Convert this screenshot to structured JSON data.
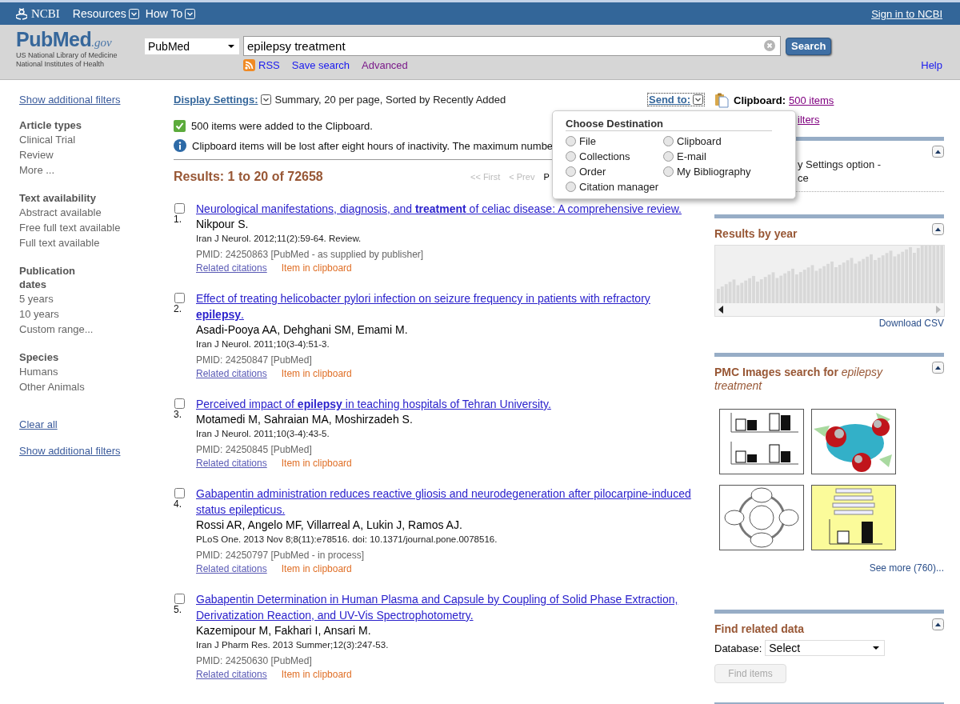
{
  "ncbi_bar": {
    "logo": "NCBI",
    "menus": [
      {
        "label": "Resources"
      },
      {
        "label": "How To"
      }
    ],
    "sign_in": "Sign in to NCBI"
  },
  "header": {
    "logo": {
      "brand": "PubMed",
      "suffix": ".gov",
      "lines": [
        "US National Library of Medicine",
        "National Institutes of Health"
      ]
    },
    "database": "PubMed",
    "query": "epilepsy treatment",
    "search_button": "Search",
    "links": [
      {
        "kind": "rss",
        "label": "RSS"
      },
      {
        "kind": "link",
        "label": "Save search"
      },
      {
        "kind": "visited",
        "label": "Advanced"
      }
    ],
    "help": "Help"
  },
  "filters": {
    "top_link": "Show additional filters",
    "groups": [
      {
        "title": "Article types",
        "items": [
          "Clinical Trial",
          "Review",
          "More ..."
        ]
      },
      {
        "title": "Text availability",
        "items": [
          "Abstract available",
          "Free full text available",
          "Full text available"
        ]
      },
      {
        "title": "Publication dates",
        "items": [
          "5 years",
          "10 years",
          "Custom range..."
        ]
      },
      {
        "title": "Species",
        "items": [
          "Humans",
          "Other Animals"
        ]
      }
    ],
    "clear": "Clear all",
    "bottom_link": "Show additional filters"
  },
  "display_settings": {
    "label": "Display Settings:",
    "value": "Summary, 20 per page, Sorted by Recently Added"
  },
  "send_to": "Send to:",
  "clipboard": {
    "label": "Clipboard:",
    "count": "500 items"
  },
  "messages": [
    {
      "kind": "success",
      "text": "500 items were added to the Clipboard."
    },
    {
      "kind": "info",
      "text": "Clipboard items will be lost after eight hours of inactivity. The maximum numbe"
    }
  ],
  "results_header": "Results: 1 to 20 of 72658",
  "pager": [
    {
      "label": "<< First",
      "disabled": true
    },
    {
      "label": "< Prev",
      "disabled": true
    },
    {
      "label": "P",
      "disabled": false
    }
  ],
  "results": [
    {
      "number": "1.",
      "checked": false,
      "title": "Neurological manifestations, diagnosis, and **treatment** of celiac disease: A comprehensive review.",
      "authors": "Nikpour S.",
      "citation": "Iran J Neurol. 2012;11(2):59-64. Review.",
      "pmid": "PMID: 24250863 [PubMed - as supplied by publisher]",
      "related": "Related citations",
      "status": "Item in clipboard"
    },
    {
      "number": "2.",
      "checked": false,
      "title": "Effect of treating helicobacter pylori infection on seizure frequency in patients with refractory **epilepsy**.",
      "authors": "Asadi-Pooya AA, Dehghani SM, Emami M.",
      "citation": "Iran J Neurol. 2011;10(3-4):51-3.",
      "pmid": "PMID: 24250847 [PubMed]",
      "related": "Related citations",
      "status": "Item in clipboard"
    },
    {
      "number": "3.",
      "checked": false,
      "title": "Perceived impact of **epilepsy** in teaching hospitals of Tehran University.",
      "authors": "Motamedi M, Sahraian MA, Moshirzadeh S.",
      "citation": "Iran J Neurol. 2011;10(3-4):43-5.",
      "pmid": "PMID: 24250845 [PubMed]",
      "related": "Related citations",
      "status": "Item in clipboard"
    },
    {
      "number": "4.",
      "checked": false,
      "title": "Gabapentin administration reduces reactive gliosis and neurodegeneration after pilocarpine-induced status epilepticus.",
      "authors": "Rossi AR, Angelo MF, Villarreal A, Lukin J, Ramos AJ.",
      "citation": "PLoS One. 2013 Nov 8;8(11):e78516. doi: 10.1371/journal.pone.0078516.",
      "pmid": "PMID: 24250797 [PubMed - in process]",
      "related": "Related citations",
      "status": "Item in clipboard"
    },
    {
      "number": "5.",
      "checked": false,
      "title": "Gabapentin Determination in Human Plasma and Capsule by Coupling of Solid Phase Extraction, Derivatization Reaction, and UV-Vis Spectrophotometry.",
      "authors": "Kazemipour M, Fakhari I, Ansari M.",
      "citation": "Iran J Pharm Res. 2013 Summer;12(3):247-53.",
      "pmid": "PMID: 24250630 [PubMed]",
      "related": "Related citations",
      "status": "Item in clipboard"
    }
  ],
  "send_to_menu": {
    "title": "Choose Destination",
    "options": [
      {
        "label": "File",
        "selected": false
      },
      {
        "label": "Collections",
        "selected": false
      },
      {
        "label": "Order",
        "selected": false
      },
      {
        "label": "Citation manager",
        "selected": false
      },
      {
        "label": "Clipboard",
        "selected": false
      },
      {
        "label": "E-mail",
        "selected": false
      },
      {
        "label": "My Bibliography",
        "selected": false
      }
    ]
  },
  "sidebar": {
    "filters_link": "ilters",
    "settings_box": [
      "y Settings option -",
      "ce"
    ],
    "results_by_year": {
      "title": "Results by year",
      "download": "Download CSV"
    },
    "pmc_images": {
      "title": "PMC Images search for *epilepsy treatment*",
      "more": "See more (760)..."
    },
    "related_data": {
      "title": "Find related data",
      "database_label": "Database:",
      "database": "Select",
      "button": "Find items",
      "button_disabled": true
    }
  }
}
